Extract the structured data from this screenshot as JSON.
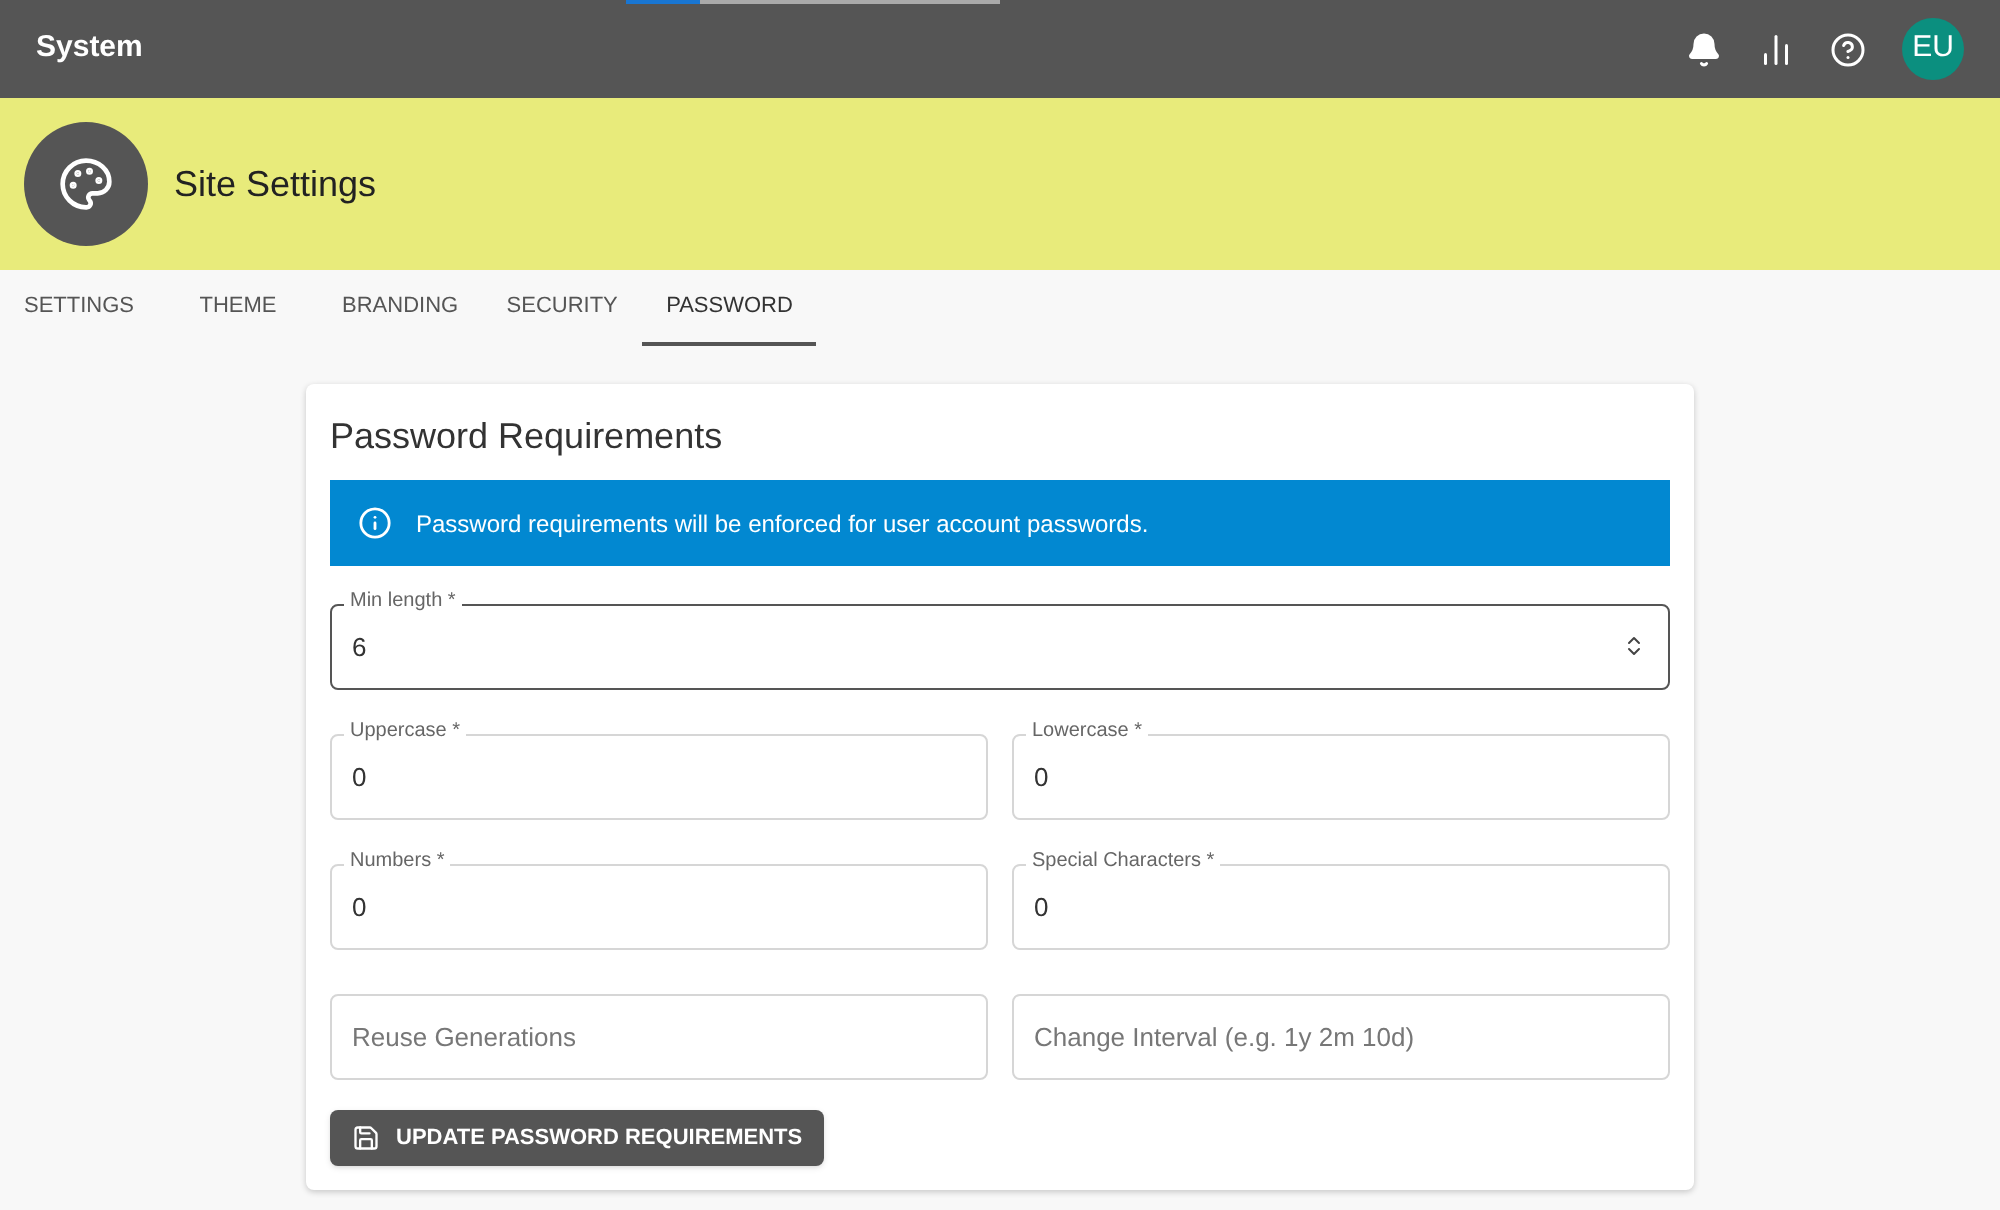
{
  "top_bar": {
    "title": "System",
    "avatar": "EU",
    "progress": {
      "level": 0.2
    }
  },
  "header": {
    "title": "Site Settings"
  },
  "tabs": [
    {
      "label": "SETTINGS",
      "selected": false
    },
    {
      "label": "THEME",
      "selected": false
    },
    {
      "label": "BRANDING",
      "selected": false
    },
    {
      "label": "SECURITY",
      "selected": false
    },
    {
      "label": "PASSWORD",
      "selected": true
    }
  ],
  "card": {
    "title": "Password Requirements",
    "alert": "Password requirements will be enforced for user account passwords.",
    "fields": [
      {
        "kind": "wide",
        "label": "Min length *",
        "value": "6",
        "focused": true
      },
      {
        "kind": "half",
        "label": "Uppercase *",
        "value": "0",
        "focused": false
      },
      {
        "kind": "half",
        "label": "Lowercase *",
        "value": "0",
        "focused": false
      },
      {
        "kind": "half",
        "label": "Numbers *",
        "value": "0",
        "focused": false
      },
      {
        "kind": "half",
        "label": "Special Characters *",
        "value": "0",
        "focused": false
      },
      {
        "kind": "half",
        "placeholder": "Reuse Generations",
        "focused": false
      },
      {
        "kind": "half",
        "placeholder": "Change Interval (e.g. 1y 2m 10d)",
        "focused": false
      }
    ],
    "button": "UPDATE PASSWORD REQUIREMENTS"
  }
}
